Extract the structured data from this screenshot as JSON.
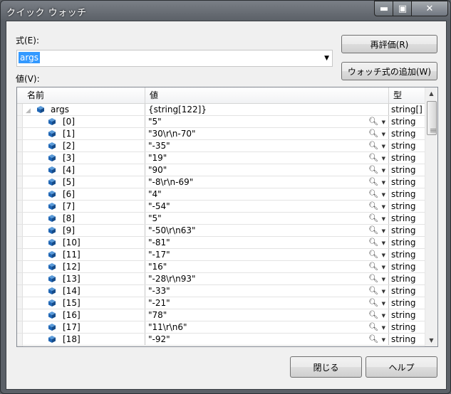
{
  "window": {
    "title": "クイック ウォッチ"
  },
  "controls": {
    "min": "▬",
    "max": "▣",
    "close": "✕"
  },
  "expression": {
    "label": "式(E):",
    "value": "args"
  },
  "value_label": "値(V):",
  "buttons": {
    "reevaluate": "再評価(R)",
    "add_watch": "ウォッチ式の追加(W)",
    "close": "閉じる",
    "help": "ヘルプ"
  },
  "grid": {
    "headers": {
      "name": "名前",
      "value": "値",
      "type": "型"
    },
    "root": {
      "name": "args",
      "value": "{string[122]}",
      "type": "string[]"
    },
    "rows": [
      {
        "name": "[0]",
        "value": "\"5\"",
        "type": "string"
      },
      {
        "name": "[1]",
        "value": "\"30\\r\\n-70\"",
        "type": "string"
      },
      {
        "name": "[2]",
        "value": "\"-35\"",
        "type": "string"
      },
      {
        "name": "[3]",
        "value": "\"19\"",
        "type": "string"
      },
      {
        "name": "[4]",
        "value": "\"90\"",
        "type": "string"
      },
      {
        "name": "[5]",
        "value": "\"-8\\r\\n-69\"",
        "type": "string"
      },
      {
        "name": "[6]",
        "value": "\"4\"",
        "type": "string"
      },
      {
        "name": "[7]",
        "value": "\"-54\"",
        "type": "string"
      },
      {
        "name": "[8]",
        "value": "\"5\"",
        "type": "string"
      },
      {
        "name": "[9]",
        "value": "\"-50\\r\\n63\"",
        "type": "string"
      },
      {
        "name": "[10]",
        "value": "\"-81\"",
        "type": "string"
      },
      {
        "name": "[11]",
        "value": "\"-17\"",
        "type": "string"
      },
      {
        "name": "[12]",
        "value": "\"16\"",
        "type": "string"
      },
      {
        "name": "[13]",
        "value": "\"-28\\r\\n93\"",
        "type": "string"
      },
      {
        "name": "[14]",
        "value": "\"-33\"",
        "type": "string"
      },
      {
        "name": "[15]",
        "value": "\"-21\"",
        "type": "string"
      },
      {
        "name": "[16]",
        "value": "\"78\"",
        "type": "string"
      },
      {
        "name": "[17]",
        "value": "\"11\\r\\n6\"",
        "type": "string"
      },
      {
        "name": "[18]",
        "value": "\"-92\"",
        "type": "string"
      }
    ]
  },
  "icons": {
    "element": "cube-icon",
    "search": "magnifier-icon",
    "dropdown": "chevron-down-icon"
  },
  "colors": {
    "selection": "#3399ff",
    "cube": "#1f66b5"
  }
}
